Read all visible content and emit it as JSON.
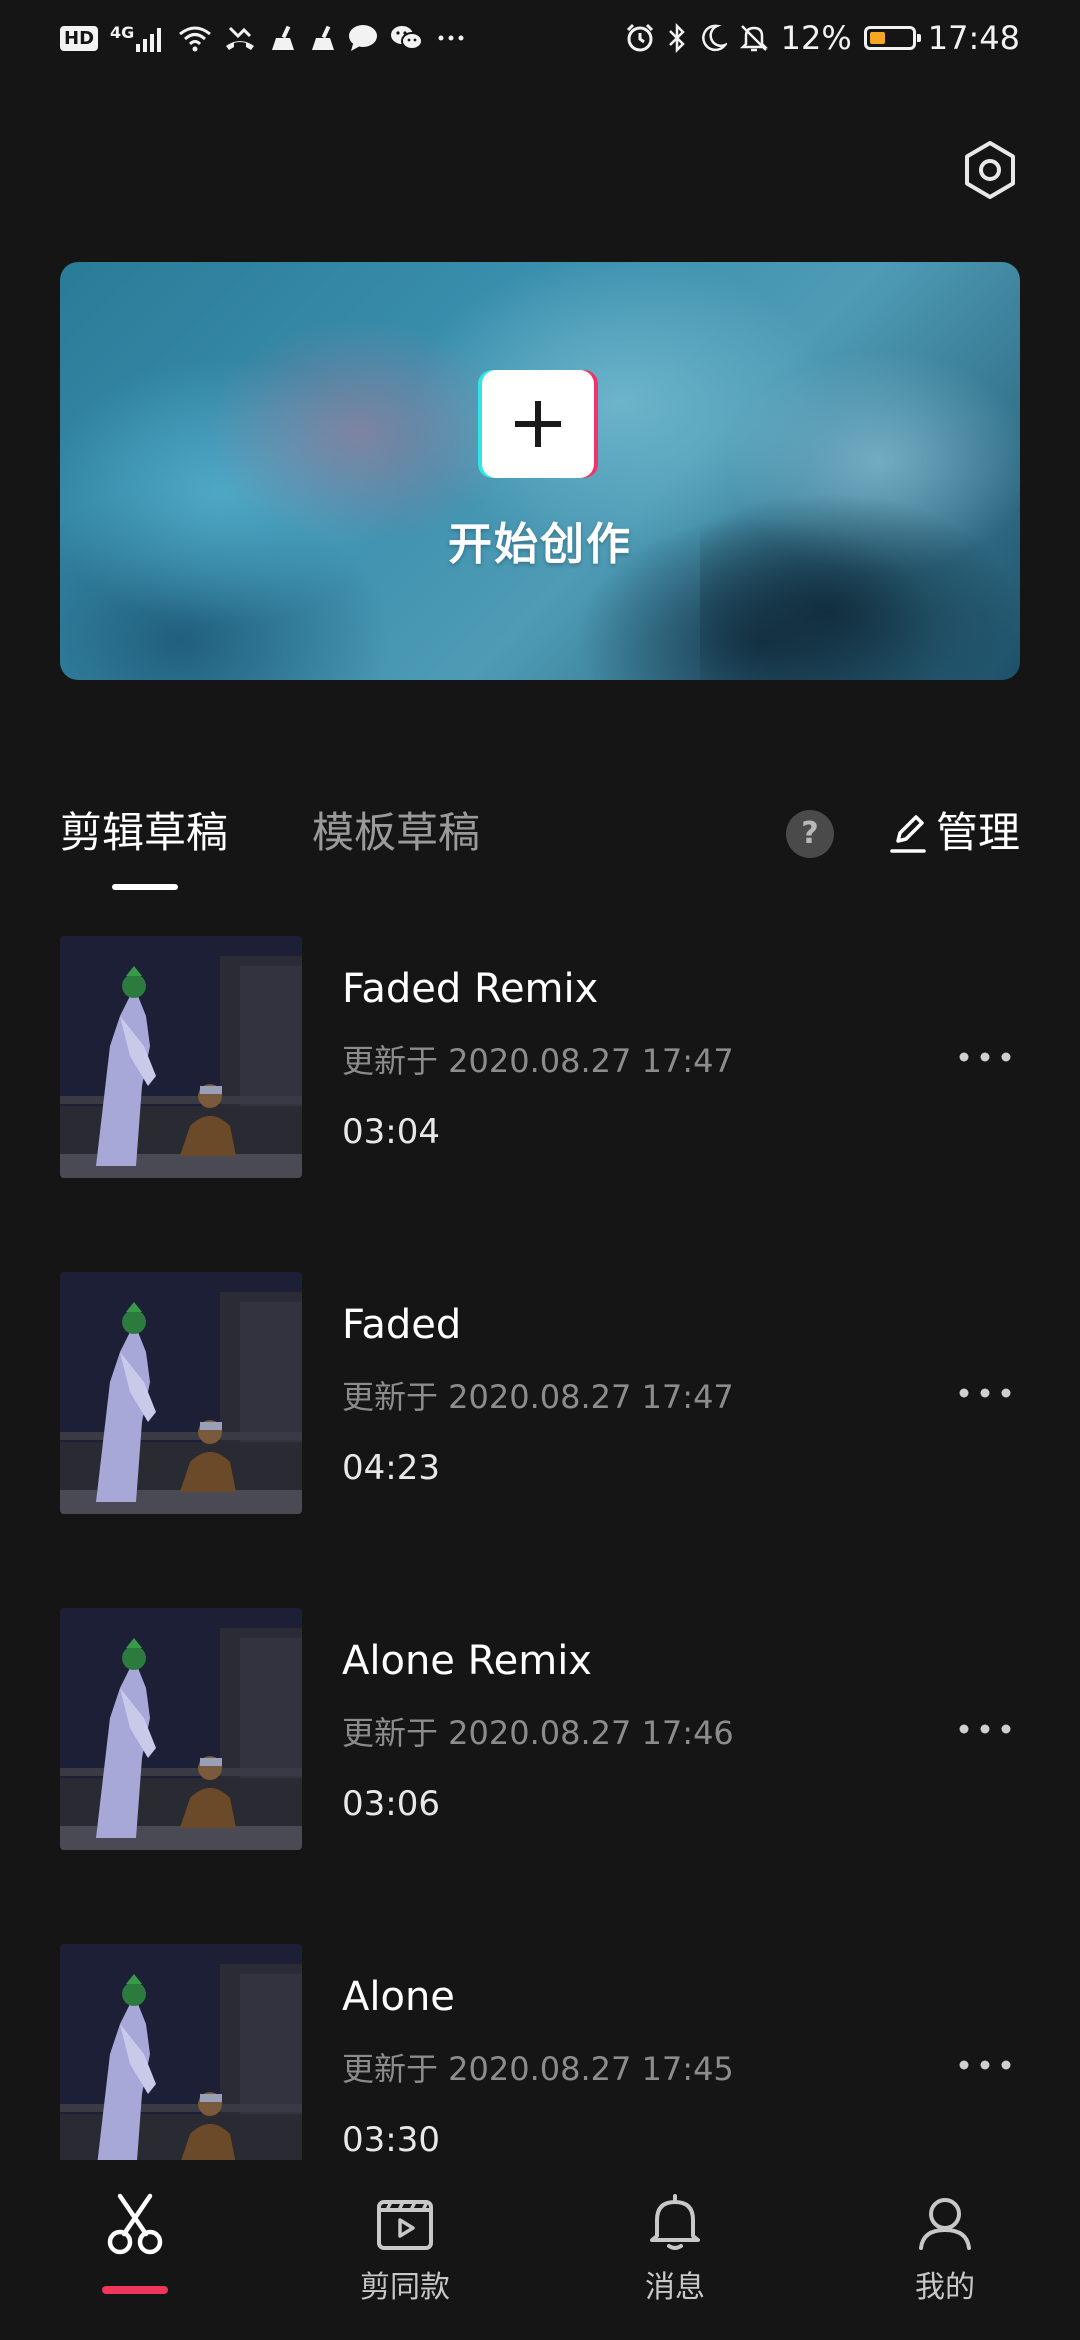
{
  "status_bar": {
    "hd": "HD",
    "network": "4G",
    "battery": "12%",
    "time": "17:48",
    "battery_level": 0.12,
    "battery_color": "#f5a623",
    "left_icons": [
      "signal-icon",
      "wifi-icon",
      "missed-call-icon",
      "cleaner-icon",
      "cleaner-icon",
      "message-icon",
      "wechat-icon",
      "more-notifications-icon"
    ],
    "right_icons": [
      "alarm-icon",
      "bluetooth-icon",
      "moon-icon",
      "mute-icon",
      "battery-icon"
    ]
  },
  "settings": {
    "icon": "settings-hexagon-icon"
  },
  "hero": {
    "title": "开始创作",
    "icon": "plus-icon"
  },
  "tabs": {
    "items": [
      {
        "label": "剪辑草稿",
        "active": true
      },
      {
        "label": "模板草稿",
        "active": false
      }
    ],
    "help": "?",
    "manage": "管理",
    "manage_icon": "edit-icon"
  },
  "drafts": [
    {
      "title": "Faded Remix",
      "updated": "更新于 2020.08.27 17:47",
      "duration": "03:04"
    },
    {
      "title": "Faded",
      "updated": "更新于 2020.08.27 17:47",
      "duration": "04:23"
    },
    {
      "title": "Alone Remix",
      "updated": "更新于 2020.08.27 17:46",
      "duration": "03:06"
    },
    {
      "title": "Alone",
      "updated": "更新于 2020.08.27 17:45",
      "duration": "03:30"
    }
  ],
  "bottom_nav": {
    "items": [
      {
        "label": "",
        "icon": "scissors-icon",
        "active": true
      },
      {
        "label": "剪同款",
        "icon": "clapper-play-icon",
        "active": false
      },
      {
        "label": "消息",
        "icon": "bell-icon",
        "active": false
      },
      {
        "label": "我的",
        "icon": "person-icon",
        "active": false
      }
    ]
  },
  "colors": {
    "background": "#151515",
    "accent": "#f0365a",
    "text_secondary": "#8c8c8c"
  }
}
